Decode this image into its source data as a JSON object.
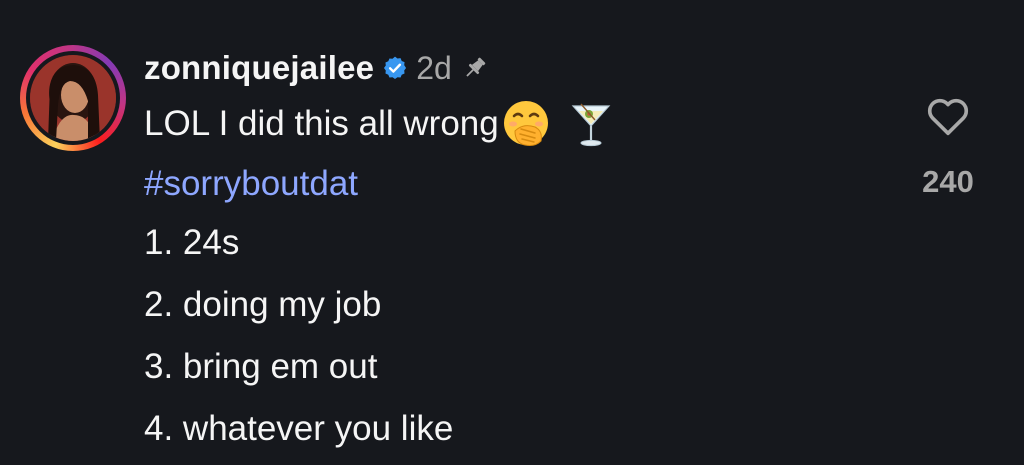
{
  "comment": {
    "username": "zonniquejailee",
    "verified_icon": "verified-badge-icon",
    "timestamp": "2d",
    "pin_icon": "pin-icon",
    "caption_text": "LOL I did this all wrong",
    "caption_emojis": [
      "face-with-hand-over-mouth-emoji",
      "cocktail-glass-emoji"
    ],
    "hashtag": "#sorryboutdat",
    "list": [
      "1. 24s",
      "2. doing my job",
      "3. bring em out",
      "4. whatever you like"
    ],
    "like_icon": "heart-icon",
    "like_count": "240"
  },
  "colors": {
    "background": "#16181d",
    "text": "#f5f5f5",
    "muted": "#a8a8a8",
    "hashtag": "#8ea7ff",
    "verified": "#3897f0"
  }
}
